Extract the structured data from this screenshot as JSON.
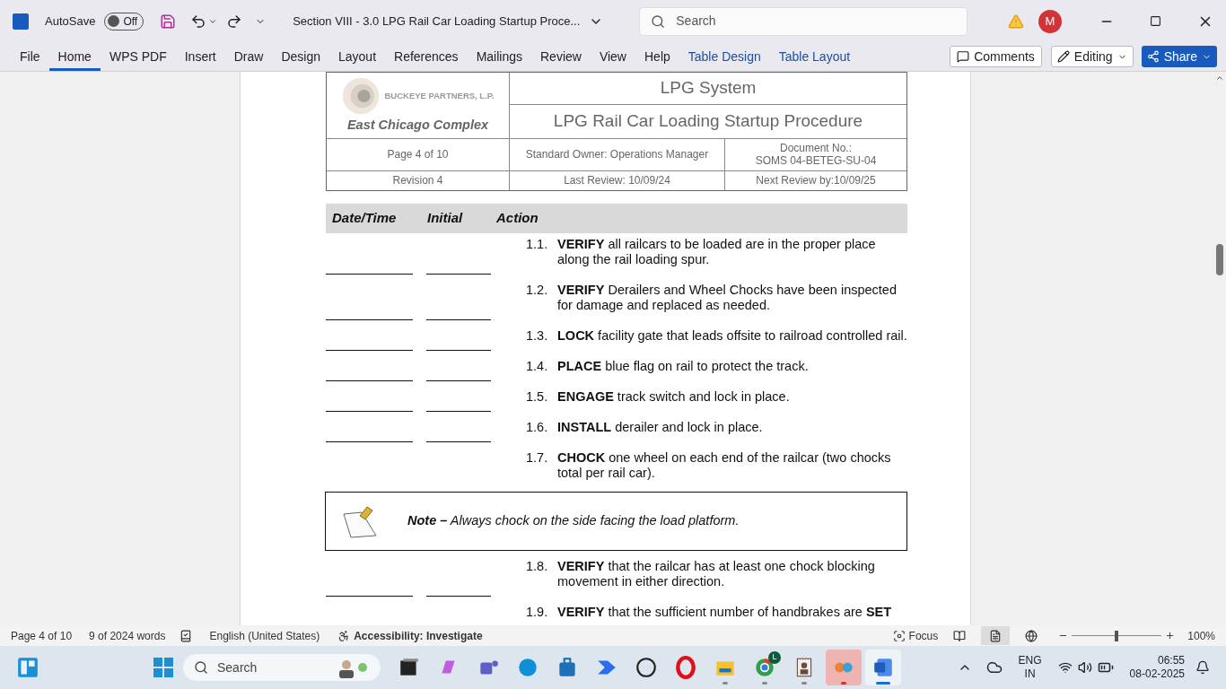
{
  "title_bar": {
    "autosave_label": "AutoSave",
    "autosave_toggle": {
      "label": "Off",
      "on": false
    },
    "doc_title": "Section VIII - 3.0 LPG Rail Car Loading Startup Proce...",
    "search_placeholder": "Search",
    "avatar_initial": "M"
  },
  "ribbon": {
    "tabs": [
      {
        "label": "File",
        "selected": false,
        "kind": "plain"
      },
      {
        "label": "Home",
        "selected": true,
        "kind": "plain"
      },
      {
        "label": "WPS PDF",
        "selected": false,
        "kind": "plain"
      },
      {
        "label": "Insert",
        "selected": false,
        "kind": "plain"
      },
      {
        "label": "Draw",
        "selected": false,
        "kind": "plain"
      },
      {
        "label": "Design",
        "selected": false,
        "kind": "plain"
      },
      {
        "label": "Layout",
        "selected": false,
        "kind": "plain"
      },
      {
        "label": "References",
        "selected": false,
        "kind": "plain"
      },
      {
        "label": "Mailings",
        "selected": false,
        "kind": "plain"
      },
      {
        "label": "Review",
        "selected": false,
        "kind": "plain"
      },
      {
        "label": "View",
        "selected": false,
        "kind": "plain"
      },
      {
        "label": "Help",
        "selected": false,
        "kind": "plain"
      },
      {
        "label": "Table Design",
        "selected": false,
        "kind": "contextual"
      },
      {
        "label": "Table Layout",
        "selected": false,
        "kind": "contextual"
      }
    ],
    "comments_button": "Comments",
    "editing_button": "Editing",
    "share_button": "Share"
  },
  "document": {
    "header": {
      "company": "BUCKEYE PARTNERS, L.P.",
      "site": "East Chicago Complex",
      "system": "LPG System",
      "procedure": "LPG Rail Car Loading Startup Procedure",
      "page": "Page 4 of 10",
      "owner": "Standard Owner: Operations Manager",
      "doc_no_label": "Document No.:",
      "doc_no": "SOMS 04-BETEG-SU-04",
      "revision": "Revision 4",
      "last_review": "Last Review: 10/09/24",
      "next_review": "Next Review by:10/09/25"
    },
    "columns": [
      "Date/Time",
      "Initial",
      "Action"
    ],
    "items": [
      {
        "kind": "step",
        "number": "1.1.",
        "text": "**VERIFY** all railcars to be loaded are in the proper place along the rail loading spur.",
        "signoff": true
      },
      {
        "kind": "step",
        "number": "1.2.",
        "text": "**VERIFY** Derailers and Wheel Chocks have been inspected for damage and replaced as needed.",
        "signoff": true
      },
      {
        "kind": "step",
        "number": "1.3.",
        "text": "**LOCK** facility gate that leads offsite to railroad controlled rail.",
        "signoff": true
      },
      {
        "kind": "step",
        "number": "1.4.",
        "text": "**PLACE** blue flag on rail to protect the track.",
        "signoff": true
      },
      {
        "kind": "step",
        "number": "1.5.",
        "text": "**ENGAGE** track switch and lock in place.",
        "signoff": true
      },
      {
        "kind": "step",
        "number": "1.6.",
        "text": "**INSTALL** derailer and lock in place.",
        "signoff": true
      },
      {
        "kind": "step",
        "number": "1.7.",
        "text": "**CHOCK** one wheel on each end of the railcar (two chocks total per rail car).",
        "signoff": false
      },
      {
        "kind": "note",
        "label": "Note –",
        "text": "Always chock on the side facing the load platform."
      },
      {
        "kind": "step",
        "number": "1.8.",
        "text": "**VERIFY** that the railcar has at least one chock blocking movement in either direction.",
        "signoff": true
      },
      {
        "kind": "step",
        "number": "1.9.",
        "text": "**VERIFY** that the sufficient number of handbrakes are **SET**"
      }
    ]
  },
  "status_bar": {
    "page": "Page 4 of 10",
    "words": "9 of 2024 words",
    "language": "English (United States)",
    "accessibility": "Accessibility: Investigate",
    "focus": "Focus",
    "views": [
      {
        "kind": "read",
        "selected": false
      },
      {
        "kind": "print",
        "selected": true
      },
      {
        "kind": "web",
        "selected": false
      }
    ],
    "zoom": {
      "level": 0.5,
      "reading": "100%"
    }
  },
  "taskbar": {
    "search_placeholder": "Search",
    "apps": [
      {
        "kind": "taskview",
        "running": false,
        "active": false
      },
      {
        "kind": "copilot",
        "running": false,
        "active": false
      },
      {
        "kind": "teams",
        "running": false,
        "active": false
      },
      {
        "kind": "edge",
        "running": false,
        "active": false
      },
      {
        "kind": "store",
        "running": false,
        "active": false
      },
      {
        "kind": "automate",
        "running": false,
        "active": false
      },
      {
        "kind": "dell",
        "running": false,
        "active": false
      },
      {
        "kind": "opera",
        "running": false,
        "active": false
      },
      {
        "kind": "explorer",
        "running": true,
        "active": false
      },
      {
        "kind": "chrome",
        "running": true,
        "active": false,
        "badge": "L"
      },
      {
        "kind": "portrait",
        "running": true,
        "active": false
      },
      {
        "kind": "puzzle",
        "running": true,
        "active": false,
        "flash": true
      },
      {
        "kind": "word",
        "running": true,
        "active": true
      }
    ],
    "language": "ENG",
    "region": "IN",
    "time": "06:55",
    "date": "08-02-2025"
  }
}
